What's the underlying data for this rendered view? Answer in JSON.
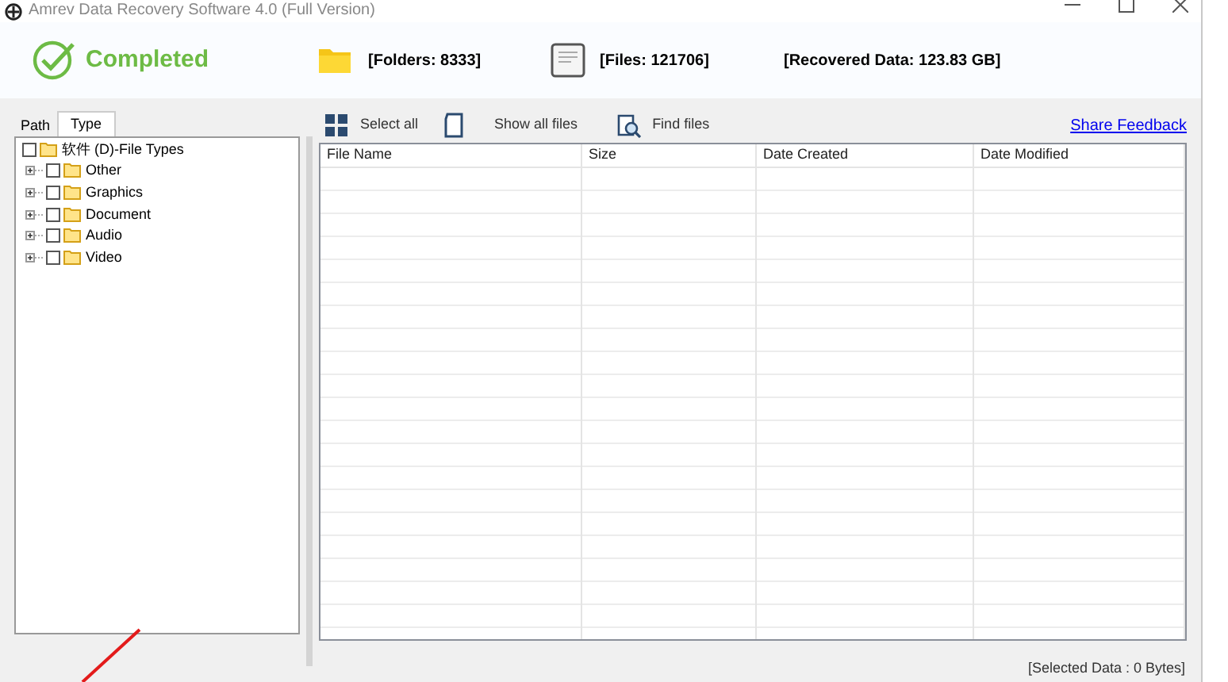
{
  "window": {
    "title": "Amrev Data Recovery Software 4.0 (Full Version)"
  },
  "summary": {
    "status": "Completed",
    "folders": "[Folders: 8333]",
    "files": "[Files: 121706]",
    "recovered": "[Recovered Data: 123.83 GB]"
  },
  "tabs": [
    {
      "label": "Path",
      "selected": false
    },
    {
      "label": "Type",
      "selected": true
    }
  ],
  "tree": {
    "label": "软件 (D)-File Types",
    "checked": false,
    "children": [
      {
        "label": "Other",
        "checked": false,
        "expanded": false
      },
      {
        "label": "Graphics",
        "checked": false,
        "expanded": false
      },
      {
        "label": "Document",
        "checked": false,
        "expanded": false
      },
      {
        "label": "Audio",
        "checked": false,
        "expanded": false
      },
      {
        "label": "Video",
        "checked": false,
        "expanded": false
      }
    ]
  },
  "toolbar": [
    {
      "kind": "select",
      "label": "Select all"
    },
    {
      "kind": "show",
      "label": "Show all files"
    },
    {
      "kind": "find",
      "label": "Find files"
    }
  ],
  "feedback_link": "Share Feedback",
  "table": {
    "columns": [
      "File Name",
      "Size",
      "Date Created",
      "Date Modified"
    ]
  },
  "status_bar": "[Selected Data : 0 Bytes]"
}
